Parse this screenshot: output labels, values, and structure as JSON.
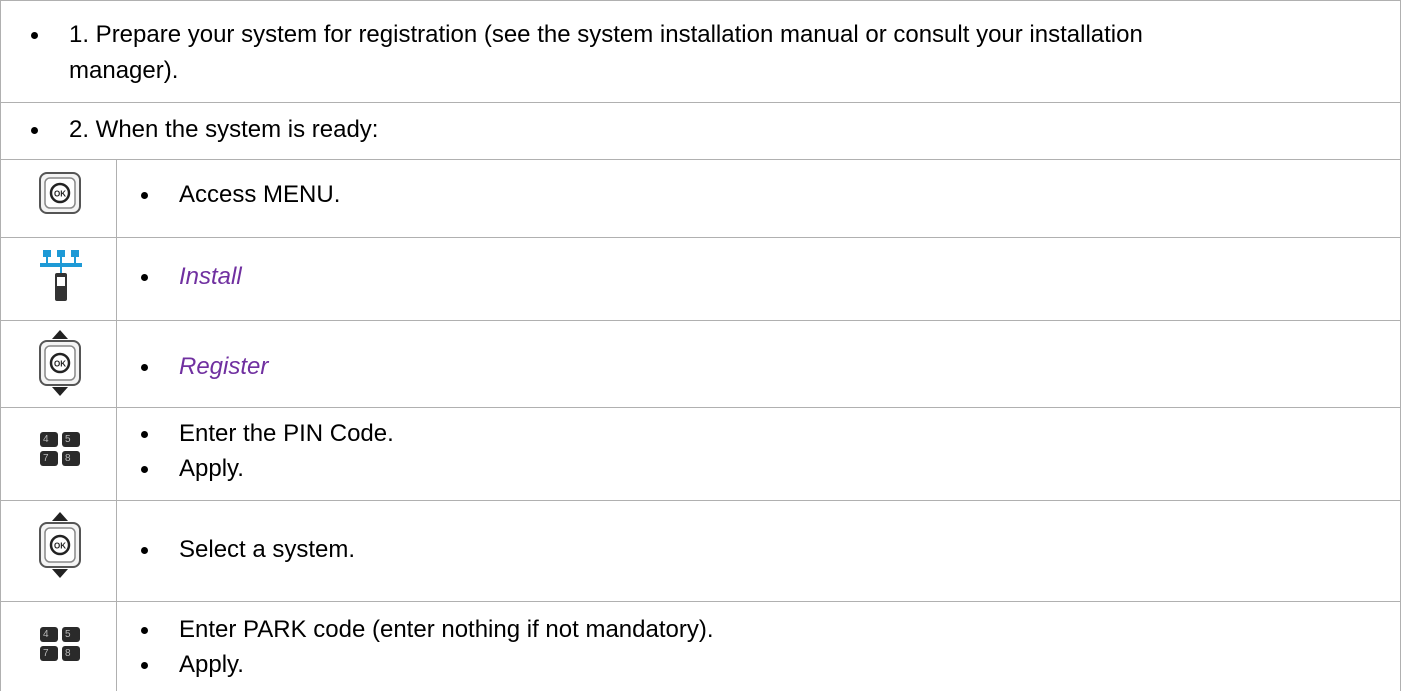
{
  "steps": {
    "step1": "1. Prepare your system for registration (see the system installation manual or consult your installation manager).",
    "step1_line1": "1. Prepare your system for registration (see the system installation manual or consult your installation",
    "step1_line2": "manager).",
    "step2": "2. When the system is ready:"
  },
  "rows": [
    {
      "icon": "ok-button-icon",
      "lines": [
        "Access MENU."
      ],
      "style": "normal"
    },
    {
      "icon": "network-handset-icon",
      "lines": [
        "Install"
      ],
      "style": "italic-purple"
    },
    {
      "icon": "ok-navigator-icon",
      "lines": [
        "Register"
      ],
      "style": "italic-purple"
    },
    {
      "icon": "keypad-icon",
      "lines": [
        "Enter the PIN Code.",
        "Apply."
      ],
      "style": "normal"
    },
    {
      "icon": "ok-navigator-icon",
      "lines": [
        "Select a system."
      ],
      "style": "normal"
    },
    {
      "icon": "keypad-icon",
      "lines": [
        "Enter PARK code (enter nothing if not mandatory).",
        "Apply."
      ],
      "style": "normal"
    }
  ],
  "keypad": {
    "k1": "4",
    "k2": "5",
    "k3": "7",
    "k4": "8"
  },
  "colors": {
    "border": "#b0b0b0",
    "emphasis": "#7030a0",
    "icon_blue": "#1e9ad6"
  }
}
